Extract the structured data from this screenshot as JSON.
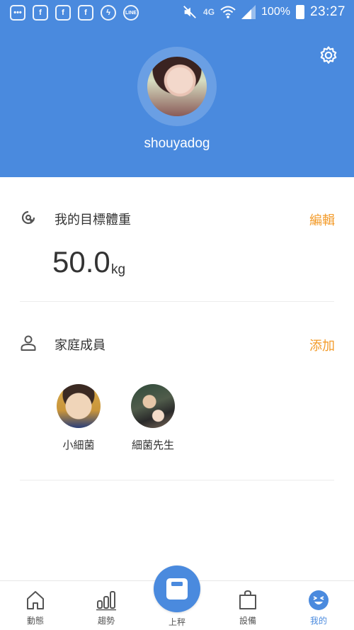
{
  "status_bar": {
    "network": "4G",
    "battery": "100%",
    "time": "23:27"
  },
  "profile": {
    "username": "shouyadog"
  },
  "goal": {
    "title": "我的目標體重",
    "action": "編輯",
    "value": "50.0",
    "unit": "kg"
  },
  "family": {
    "title": "家庭成員",
    "action": "添加",
    "members": [
      {
        "name": "小細菌"
      },
      {
        "name": "細菌先生"
      }
    ]
  },
  "nav": {
    "items": [
      {
        "label": "動態",
        "icon": "home-icon"
      },
      {
        "label": "趨勢",
        "icon": "bar-chart-icon"
      },
      {
        "label": "上秤",
        "icon": "scale-icon"
      },
      {
        "label": "設備",
        "icon": "bag-icon"
      },
      {
        "label": "我的",
        "icon": "smiley-icon"
      }
    ],
    "active": "我的"
  },
  "colors": {
    "primary": "#4a8ade",
    "accent": "#f39b2a"
  }
}
